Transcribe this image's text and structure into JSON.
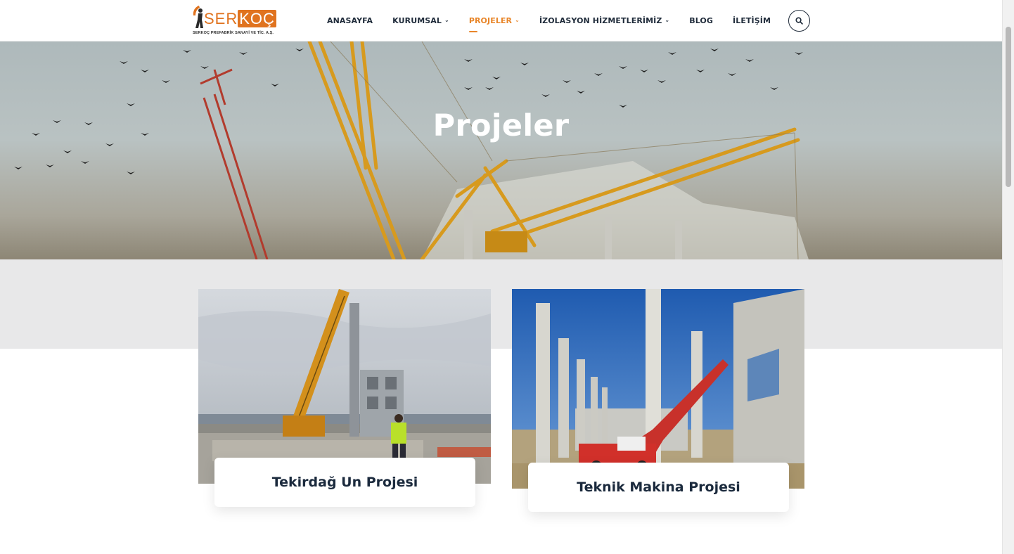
{
  "brand": {
    "logo_word_left": "SER",
    "logo_word_right": "KOÇ",
    "logo_tagline": "SERKOÇ PREFABRİK SANAYİ VE TİC. A.Ş.",
    "accent_color": "#e8862a",
    "dark_color": "#1b2a3d"
  },
  "nav": {
    "items": [
      {
        "label": "ANASAYFA",
        "dropdown": false
      },
      {
        "label": "KURUMSAL",
        "dropdown": true
      },
      {
        "label": "PROJELER",
        "dropdown": true,
        "active": true
      },
      {
        "label": "İZOLASYON HİZMETLERİMİZ",
        "dropdown": true
      },
      {
        "label": "BLOG",
        "dropdown": false
      },
      {
        "label": "İLETİŞİM",
        "dropdown": false
      }
    ],
    "search_icon": "search-icon"
  },
  "hero": {
    "title": "Projeler"
  },
  "projects": [
    {
      "title": "Tekirdağ Un Projesi"
    },
    {
      "title": "Teknik Makina Projesi"
    }
  ]
}
